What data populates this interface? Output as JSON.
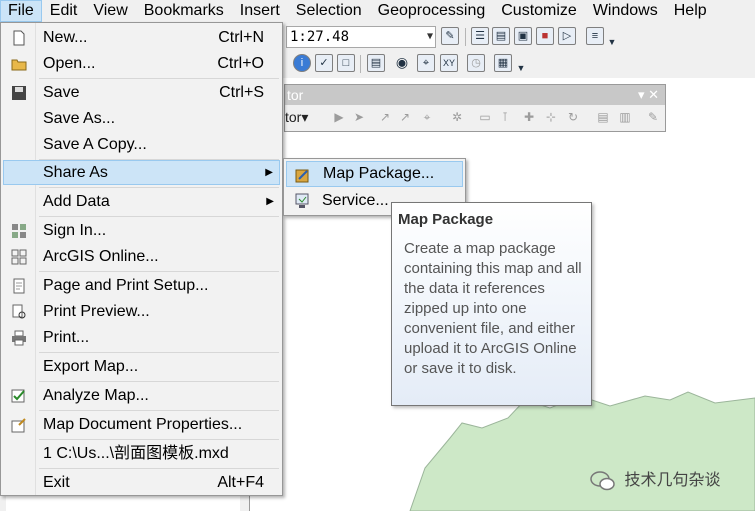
{
  "menubar": {
    "items": [
      {
        "label": "File"
      },
      {
        "label": "Edit"
      },
      {
        "label": "View"
      },
      {
        "label": "Bookmarks"
      },
      {
        "label": "Insert"
      },
      {
        "label": "Selection"
      },
      {
        "label": "Geoprocessing"
      },
      {
        "label": "Customize"
      },
      {
        "label": "Windows"
      },
      {
        "label": "Help"
      }
    ]
  },
  "toolbar": {
    "scale": "1:27.48"
  },
  "editor": {
    "title": "tor",
    "dropdown_label": "tor▾",
    "controls": "▾ ✕"
  },
  "file_menu": {
    "items": [
      {
        "label": "New...",
        "shortcut": "Ctrl+N",
        "icon": "new-document-icon"
      },
      {
        "label": "Open...",
        "shortcut": "Ctrl+O",
        "icon": "open-folder-icon"
      },
      {
        "label": "Save",
        "shortcut": "Ctrl+S",
        "icon": "save-disk-icon"
      },
      {
        "label": "Save As...",
        "shortcut": ""
      },
      {
        "label": "Save A Copy...",
        "shortcut": ""
      },
      {
        "label": "Share As",
        "submenu": true
      },
      {
        "label": "Add Data",
        "submenu": true
      },
      {
        "label": "Sign In...",
        "icon": "sign-in-icon"
      },
      {
        "label": "ArcGIS Online...",
        "icon": "arcgis-online-icon"
      },
      {
        "label": "Page and Print Setup...",
        "icon": "page-setup-icon"
      },
      {
        "label": "Print Preview...",
        "icon": "print-preview-icon"
      },
      {
        "label": "Print...",
        "icon": "printer-icon"
      },
      {
        "label": "Export Map..."
      },
      {
        "label": "Analyze Map...",
        "icon": "analyze-map-icon"
      },
      {
        "label": "Map Document Properties...",
        "icon": "properties-icon"
      },
      {
        "label": "1 C:\\Us...\\剖面图模板.mxd"
      },
      {
        "label": "Exit",
        "shortcut": "Alt+F4"
      }
    ]
  },
  "share_submenu": {
    "items": [
      {
        "label": "Map Package...",
        "icon": "map-package-icon"
      },
      {
        "label": "Service...",
        "icon": "service-icon"
      }
    ]
  },
  "tooltip": {
    "title": "Map Package",
    "body": "Create a map package containing this map and all the data it references zipped up into one convenient file, and either upload it to ArcGIS Online or save it to disk."
  },
  "watermark": {
    "text": "技术几句杂谈"
  },
  "colors": {
    "menu_highlight": "#cce4f7",
    "map_land": "#cde8c7"
  }
}
